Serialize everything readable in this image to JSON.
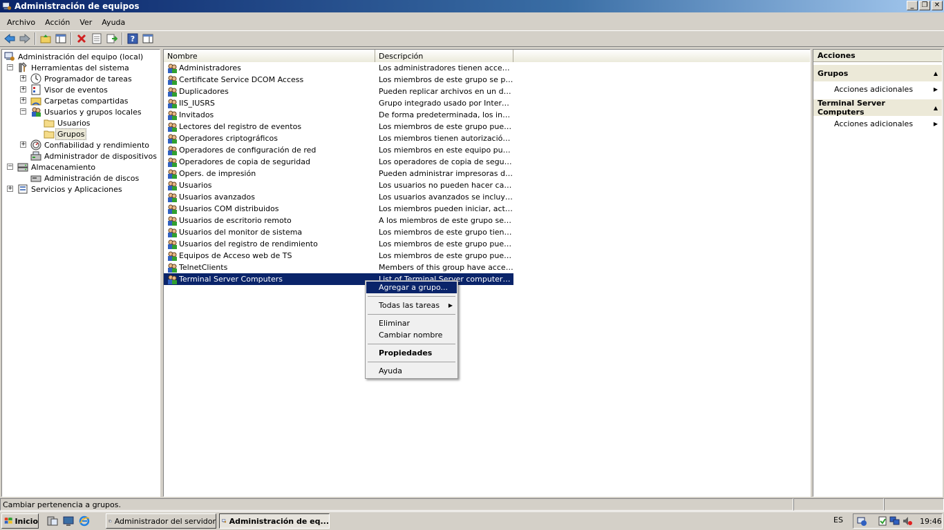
{
  "window": {
    "title": "Administración de equipos"
  },
  "menu": [
    "Archivo",
    "Acción",
    "Ver",
    "Ayuda"
  ],
  "tree": {
    "root": "Administración del equipo (local)",
    "system_tools": "Herramientas del sistema",
    "task_scheduler": "Programador de tareas",
    "event_viewer": "Visor de eventos",
    "shared_folders": "Carpetas compartidas",
    "local_users": "Usuarios y grupos locales",
    "users": "Usuarios",
    "groups": "Grupos",
    "reliability": "Confiabilidad y rendimiento",
    "device_manager": "Administrador de dispositivos",
    "storage": "Almacenamiento",
    "disk_mgmt": "Administración de discos",
    "services_apps": "Servicios y Aplicaciones"
  },
  "list": {
    "headers": {
      "name": "Nombre",
      "desc": "Descripción"
    },
    "rows": [
      {
        "name": "Administradores",
        "desc": "Los administradores tienen acceso c..."
      },
      {
        "name": "Certificate Service DCOM Access",
        "desc": "Los miembros de este grupo se pued..."
      },
      {
        "name": "Duplicadores",
        "desc": "Pueden replicar archivos en un dominio"
      },
      {
        "name": "IIS_IUSRS",
        "desc": "Grupo integrado usado por Internet ..."
      },
      {
        "name": "Invitados",
        "desc": "De forma predeterminada, los invita..."
      },
      {
        "name": "Lectores del registro de eventos",
        "desc": "Los miembros de este grupo pueden ..."
      },
      {
        "name": "Operadores criptográficos",
        "desc": "Los miembros tienen autorización pa..."
      },
      {
        "name": "Operadores de configuración de red",
        "desc": "Los miembros en este equipo puede..."
      },
      {
        "name": "Operadores de copia de seguridad",
        "desc": "Los operadores de copia de segurida..."
      },
      {
        "name": "Opers. de impresión",
        "desc": "Pueden administrar impresoras del d..."
      },
      {
        "name": "Usuarios",
        "desc": "Los usuarios no pueden hacer cambi..."
      },
      {
        "name": "Usuarios avanzados",
        "desc": "Los usuarios avanzados se incluyen ..."
      },
      {
        "name": "Usuarios COM distribuidos",
        "desc": "Los miembros pueden iniciar, activar ..."
      },
      {
        "name": "Usuarios de escritorio remoto",
        "desc": "A los miembros de este grupo se les ..."
      },
      {
        "name": "Usuarios del monitor de sistema",
        "desc": "Los miembros de este grupo tienen a..."
      },
      {
        "name": "Usuarios del registro de rendimiento",
        "desc": "Los miembros de este grupo pueden ..."
      },
      {
        "name": "Equipos de Acceso web de TS",
        "desc": "Los miembros de este grupo pueden ..."
      },
      {
        "name": "TelnetClients",
        "desc": "Members of this group have access t..."
      },
      {
        "name": "Terminal Server Computers",
        "desc": "List of Terminal Server computers all..."
      }
    ]
  },
  "actions": {
    "title": "Acciones",
    "section1": "Grupos",
    "section1_item": "Acciones adicionales",
    "section2": "Terminal Server Computers",
    "section2_item": "Acciones adicionales"
  },
  "context_menu": {
    "add_to_group": "Agregar a grupo...",
    "all_tasks": "Todas las tareas",
    "delete": "Eliminar",
    "rename": "Cambiar nombre",
    "properties": "Propiedades",
    "help": "Ayuda"
  },
  "status": {
    "text": "Cambiar pertenencia a grupos."
  },
  "taskbar": {
    "start": "Inicio",
    "task1": "Administrador del servidor",
    "task2": "Administración de eq...",
    "lang": "ES",
    "clock": "19:46"
  },
  "colors": {
    "selection": "#0a246a",
    "titlebar": "#0a246a"
  }
}
